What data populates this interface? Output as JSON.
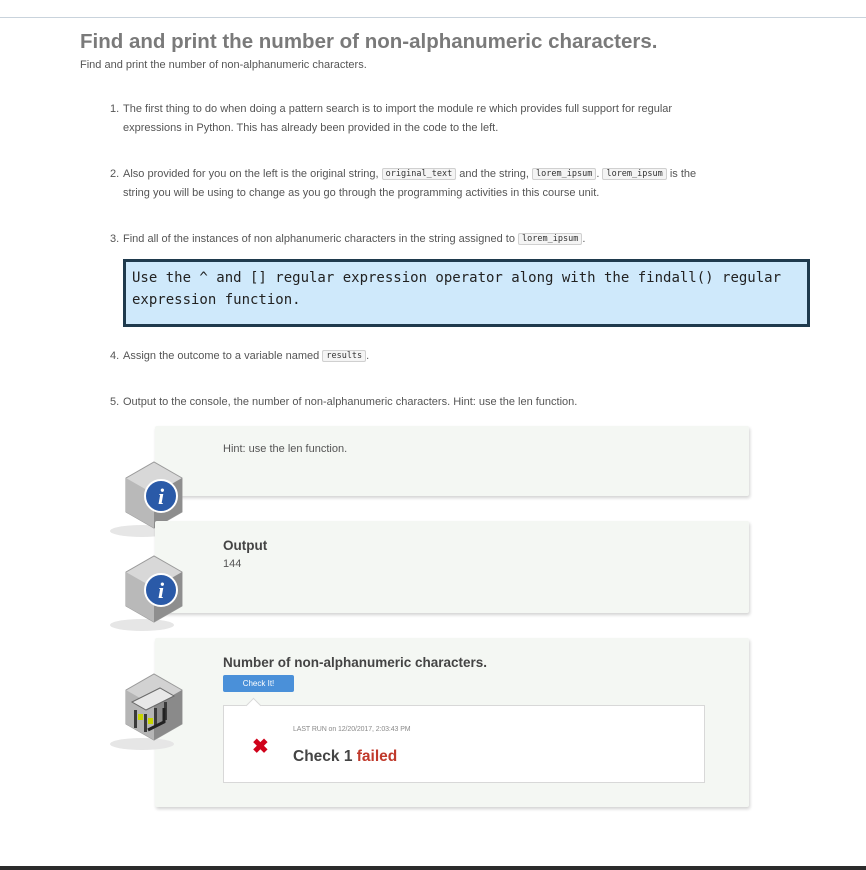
{
  "page": {
    "title": "Find and print the number of non-alphanumeric characters.",
    "subtitle": "Find and print the number of non-alphanumeric characters."
  },
  "steps": [
    {
      "num": "1.",
      "line1": "The first thing to do when doing a pattern search is to import the module re which provides full support for regular",
      "line2": "expressions in Python. This has already been provided in the code to the left."
    },
    {
      "num": "2.",
      "a": "Also provided for you on the left is the original string,",
      "code1": "original_text",
      "b": "and the string,",
      "code2": "lorem_ipsum",
      "c": ".",
      "code3": "lorem_ipsum",
      "d": "is the",
      "line2": "string you will be using to change as you go through the programming activities in this course unit."
    },
    {
      "num": "3.",
      "a": "Find all of the instances of non alphanumeric characters in the string assigned to",
      "code1": "lorem_ipsum",
      "b": "."
    },
    {
      "num": "4.",
      "a": "Assign the outcome to a variable named",
      "code1": "results",
      "b": "."
    },
    {
      "num": "5.",
      "a": "Output to the console, the number of non-alphanumeric characters. Hint: use the len function."
    }
  ],
  "callout": {
    "line1": "Use the ^ and [] regular expression operator along with the findall() regular",
    "line2": "expression function."
  },
  "hint_panel": {
    "text": "Hint: use the len function.",
    "icon": "info-icon"
  },
  "output_panel": {
    "heading": "Output",
    "value": "144",
    "icon": "info-icon"
  },
  "check_panel": {
    "heading": "Number of non-alphanumeric characters.",
    "button_label": "Check It!",
    "last_run": "LAST RUN on 12/20/2017, 2:03:43 PM",
    "result_prefix": "Check 1",
    "result_status": "failed",
    "fail_icon": "close-x-icon",
    "badge_icon": "test-bench-icon"
  },
  "colors": {
    "callout_bg": "#cfe9fb",
    "callout_border": "#1f3a4d",
    "button": "#4a90d9",
    "failed": "#c0392b",
    "fail_icon": "#d0021b",
    "info_icon": "#2a5aa8"
  }
}
